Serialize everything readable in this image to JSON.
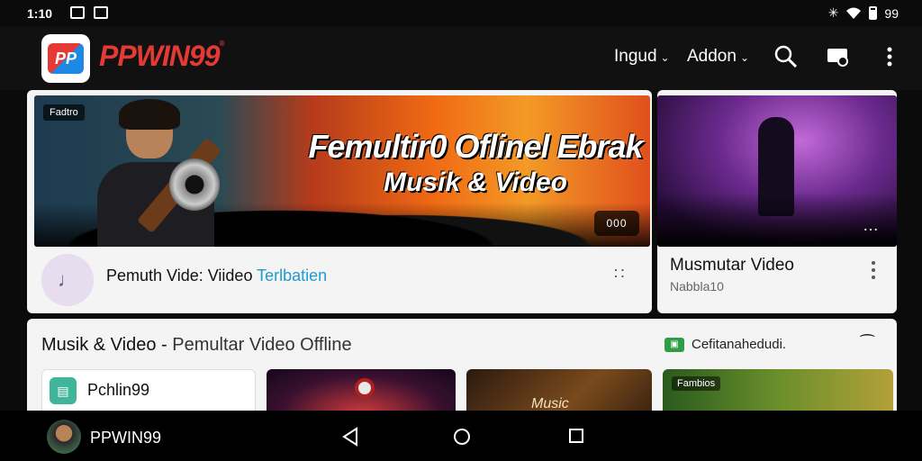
{
  "status_bar": {
    "time": "1:10",
    "battery": "99"
  },
  "app_bar": {
    "logo_text": "PP",
    "brand": "PPWIN99",
    "brand_mark": "®",
    "menu1": "Ingud",
    "menu2": "Addon"
  },
  "hero": {
    "tag": "Fadtro",
    "title_line1": "Femultir0 Oflinel Ebrak",
    "title_line2": "Musik & Video",
    "pill_label": "000",
    "caption_main": "Pemuth Vide: Viideo ",
    "caption_accent": "Terlbatien"
  },
  "side_card": {
    "title": "Musmutar Video",
    "subtitle": "Nabbla10"
  },
  "section": {
    "title_main": "Musik & Video - ",
    "title_rest": "Pemultar Video Offline",
    "filter_label": "Cefitanahedudi.",
    "cards": [
      {
        "label": "Pchlin99"
      },
      {
        "label": ""
      },
      {
        "label": "Music"
      },
      {
        "label": "Fambios"
      }
    ]
  },
  "nav_bar": {
    "label": "PPWIN99"
  }
}
